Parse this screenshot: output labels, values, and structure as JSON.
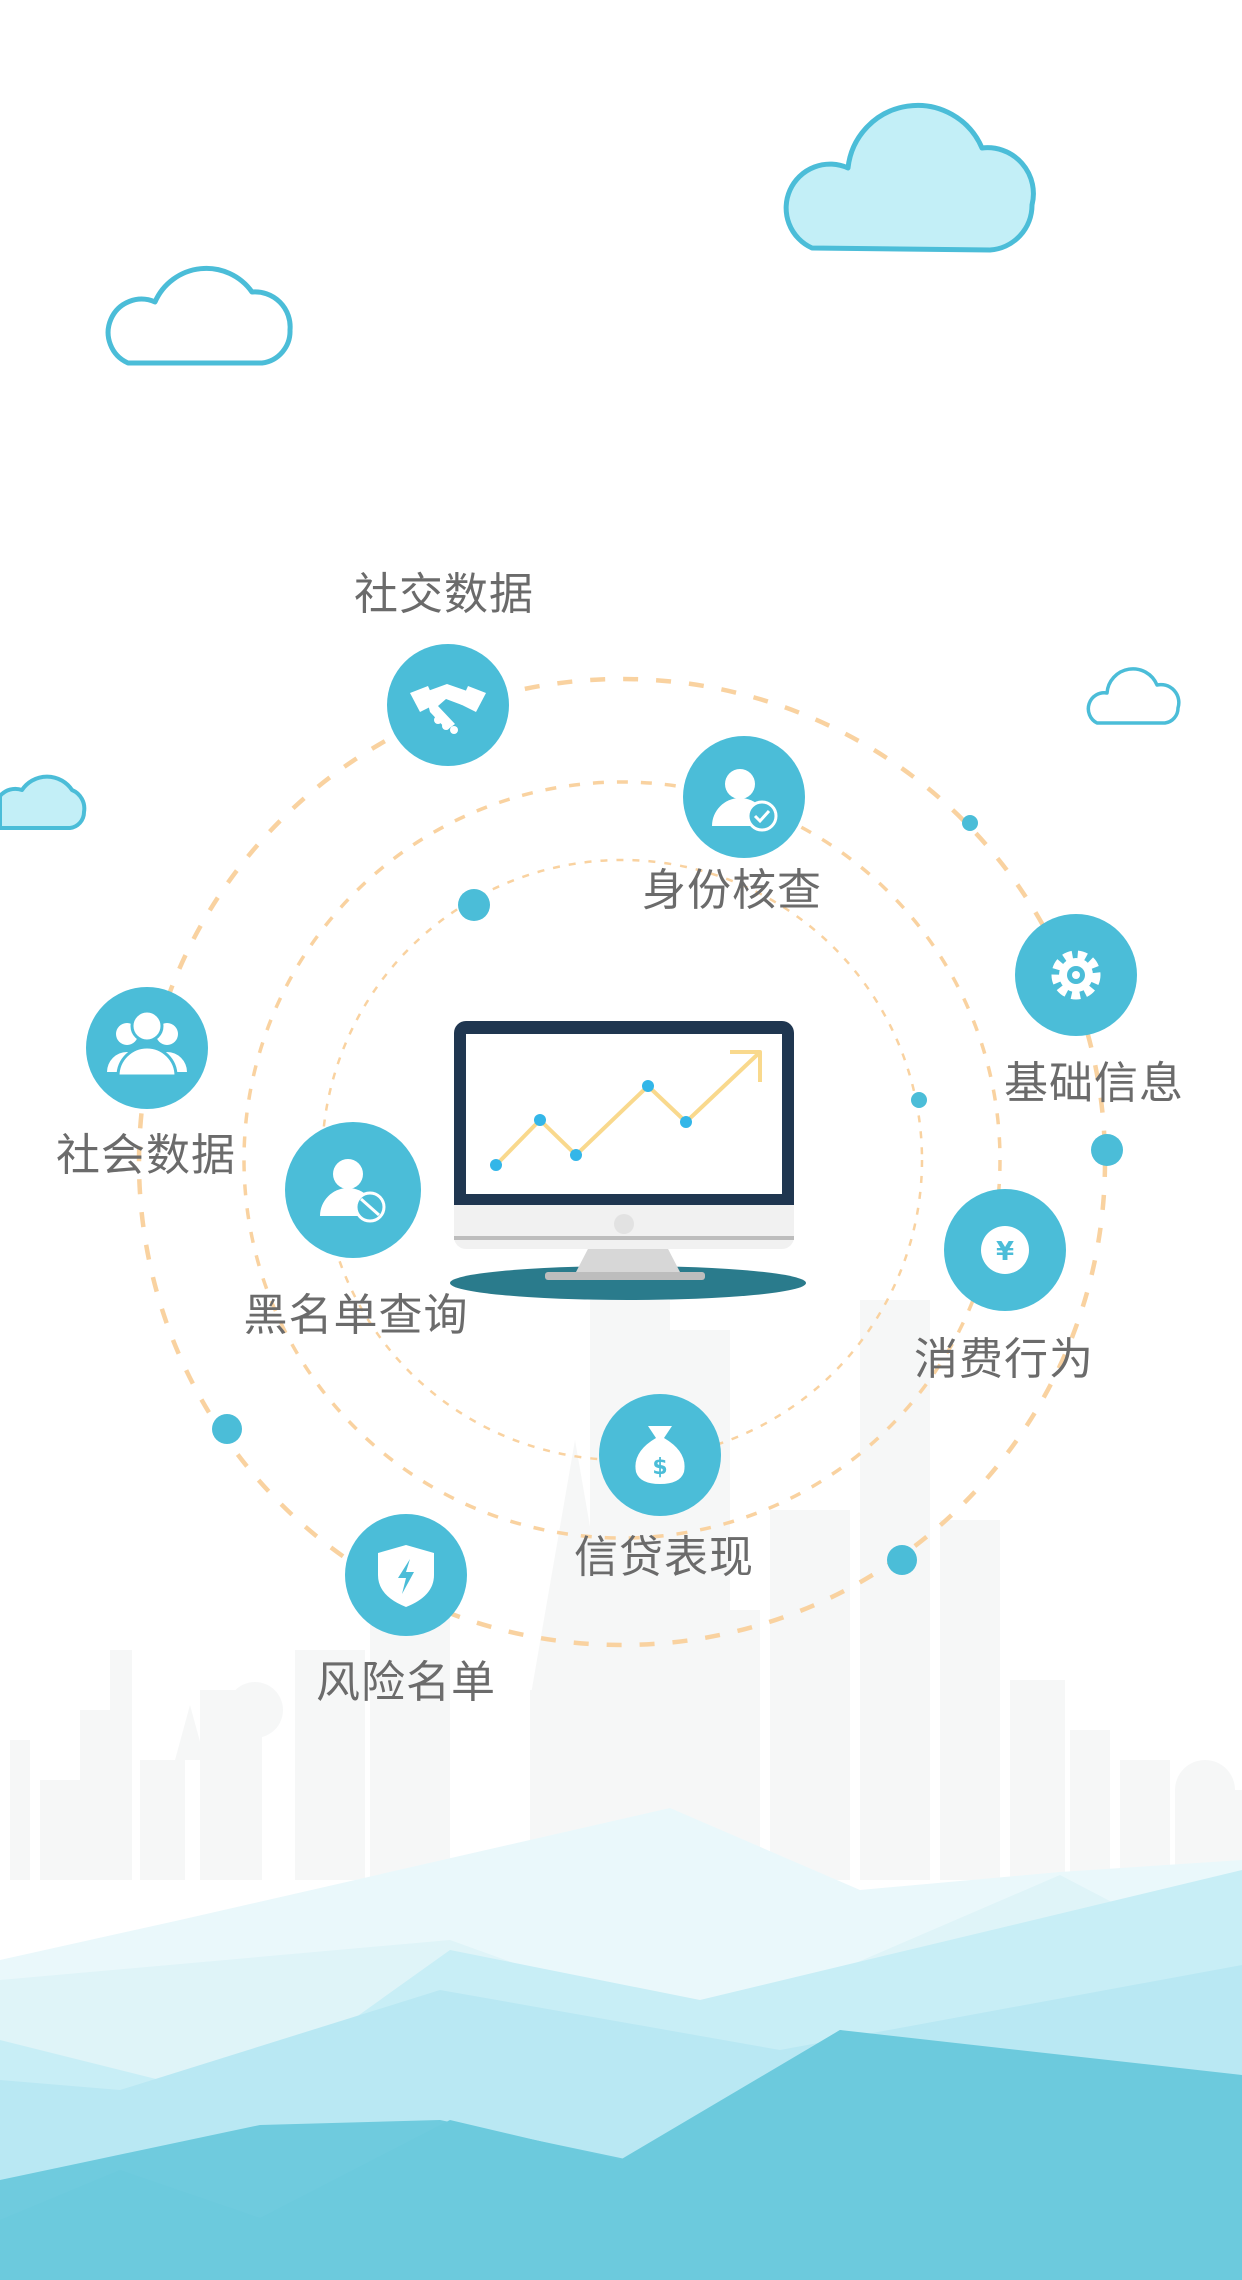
{
  "colors": {
    "accent": "#4bbdd8",
    "orbit": "#f9d2a0",
    "label": "#6b6b6b",
    "cloud_stroke": "#4bbdd8",
    "cloud_fill": "#c3eff7",
    "monitor_frame": "#1f3650",
    "monitor_stand": "#2a7b8c",
    "chart_line": "#f9d98d",
    "chart_point": "#33b6e8"
  },
  "nodes": [
    {
      "id": "social-data",
      "label": "社交数据",
      "icon": "handshake-icon"
    },
    {
      "id": "identity-check",
      "label": "身份核查",
      "icon": "user-verified-icon"
    },
    {
      "id": "basic-info",
      "label": "基础信息",
      "icon": "gear-icon"
    },
    {
      "id": "consumption",
      "label": "消费行为",
      "icon": "yen-coin-icon"
    },
    {
      "id": "credit-performance",
      "label": "信贷表现",
      "icon": "money-bag-icon"
    },
    {
      "id": "risk-list",
      "label": "风险名单",
      "icon": "shield-bolt-icon"
    },
    {
      "id": "blacklist-query",
      "label": "黑名单查询",
      "icon": "user-blocked-icon"
    },
    {
      "id": "society-data",
      "label": "社会数据",
      "icon": "user-group-icon"
    }
  ],
  "monitor": {
    "icon": "monitor-icon",
    "chart_icon": "trend-chart-icon",
    "arrow_icon": "trend-arrow-icon"
  }
}
